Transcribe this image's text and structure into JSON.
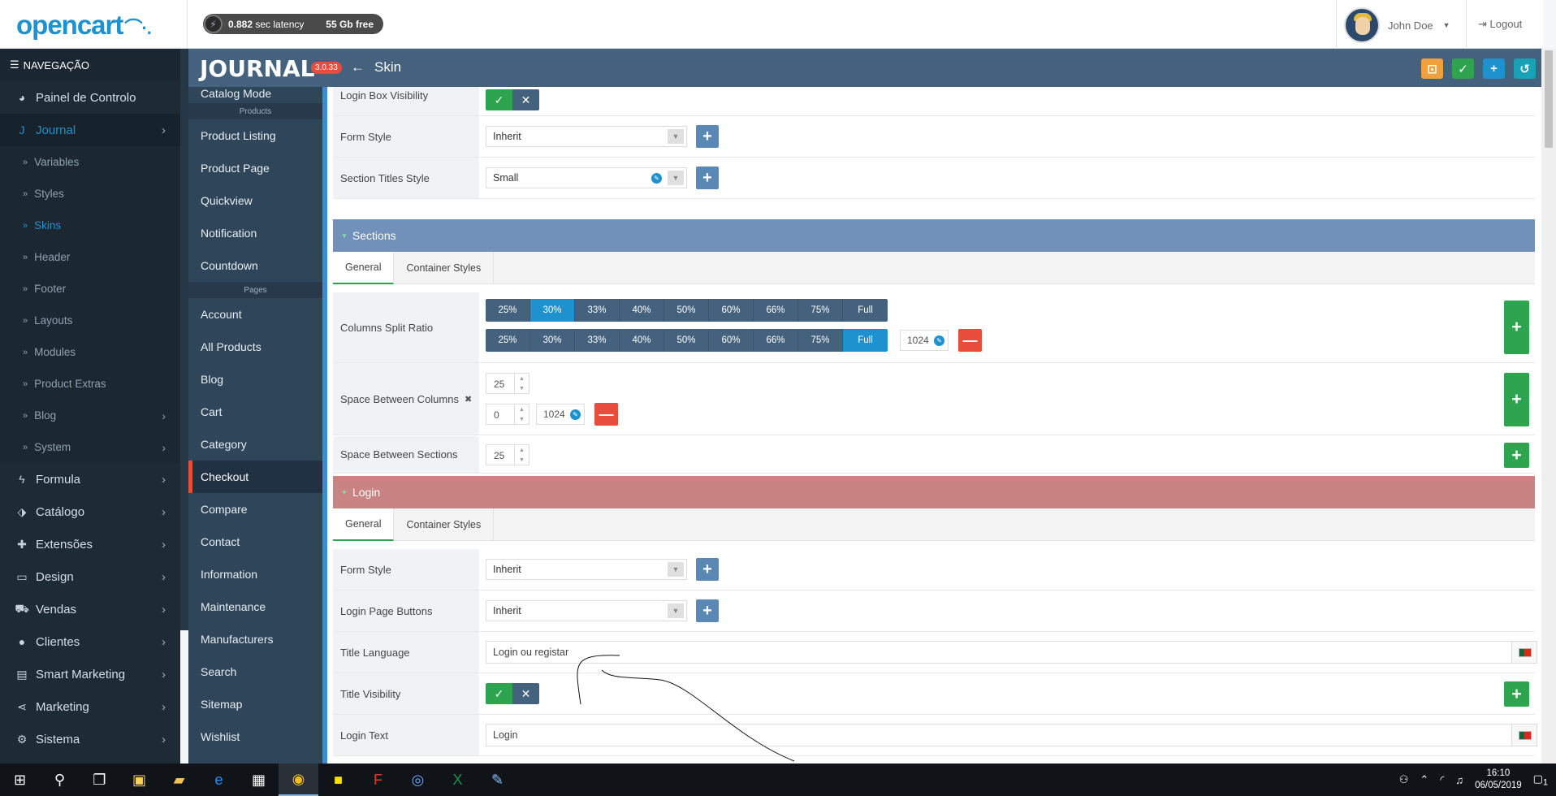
{
  "topbar": {
    "logo": "opencart",
    "latency_value": "0.882",
    "latency_unit": "sec latency",
    "disk_free": "55 Gb free",
    "user_name": "John Doe",
    "logout": "Logout"
  },
  "leftnav": {
    "header": "NAVEGAÇÃO",
    "items": [
      {
        "label": "Painel de Controlo",
        "icon": "dashboard-icon"
      },
      {
        "label": "Journal",
        "icon": "journal-icon"
      },
      {
        "label": "Formula",
        "icon": "bolt-icon"
      },
      {
        "label": "Catálogo",
        "icon": "tag-icon"
      },
      {
        "label": "Extensões",
        "icon": "puzzle-icon"
      },
      {
        "label": "Design",
        "icon": "monitor-icon"
      },
      {
        "label": "Vendas",
        "icon": "cart-icon"
      },
      {
        "label": "Clientes",
        "icon": "user-icon"
      },
      {
        "label": "Smart Marketing",
        "icon": "newspaper-icon"
      },
      {
        "label": "Marketing",
        "icon": "share-icon"
      },
      {
        "label": "Sistema",
        "icon": "gear-icon"
      }
    ],
    "journal_sub": [
      "Variables",
      "Styles",
      "Skins",
      "Header",
      "Footer",
      "Layouts",
      "Modules",
      "Product Extras",
      "Blog",
      "System"
    ]
  },
  "journal": {
    "logo": "JOURNAL",
    "version": "3.0.33",
    "page_title": "Skin",
    "menu_top": [
      "Catalog Mode"
    ],
    "section_products": "Products",
    "menu_products": [
      "Product Listing",
      "Product Page",
      "Quickview",
      "Notification",
      "Countdown"
    ],
    "section_pages": "Pages",
    "menu_pages": [
      "Account",
      "All Products",
      "Blog",
      "Cart",
      "Category",
      "Checkout",
      "Compare",
      "Contact",
      "Information",
      "Maintenance",
      "Manufacturers",
      "Search",
      "Sitemap",
      "Wishlist"
    ]
  },
  "form": {
    "login_box_visibility": "Login Box Visibility",
    "form_style": "Form Style",
    "form_style_value": "Inherit",
    "section_titles_style": "Section Titles Style",
    "section_titles_value": "Small",
    "sections_header": "Sections",
    "tab_general": "General",
    "tab_container": "Container Styles",
    "columns_split_ratio": "Columns Split Ratio",
    "ratios": [
      "25%",
      "30%",
      "33%",
      "40%",
      "50%",
      "60%",
      "66%",
      "75%",
      "Full"
    ],
    "ratio_row1_selected": "30%",
    "ratio_row2_selected": "Full",
    "breakpoint": "1024",
    "space_between_columns": "Space Between Columns",
    "space_cols_value": "25",
    "space_cols_value2": "0",
    "space_between_sections": "Space Between Sections",
    "space_sections_value": "25",
    "login_header": "Login",
    "login_form_style": "Form Style",
    "login_form_style_value": "Inherit",
    "login_page_buttons": "Login Page Buttons",
    "login_page_buttons_value": "Inherit",
    "title_language": "Title Language",
    "title_language_value": "Login ou registar",
    "title_visibility": "Title Visibility",
    "login_text": "Login Text",
    "login_text_value": "Login"
  },
  "taskbar": {
    "time": "16:10",
    "date": "06/05/2019",
    "notification_count": "1"
  },
  "colors": {
    "accent": "#1e91cf",
    "sections_header": "#7291ba",
    "login_header": "#c98383",
    "success": "#2fa44f",
    "danger": "#e74c3c"
  }
}
